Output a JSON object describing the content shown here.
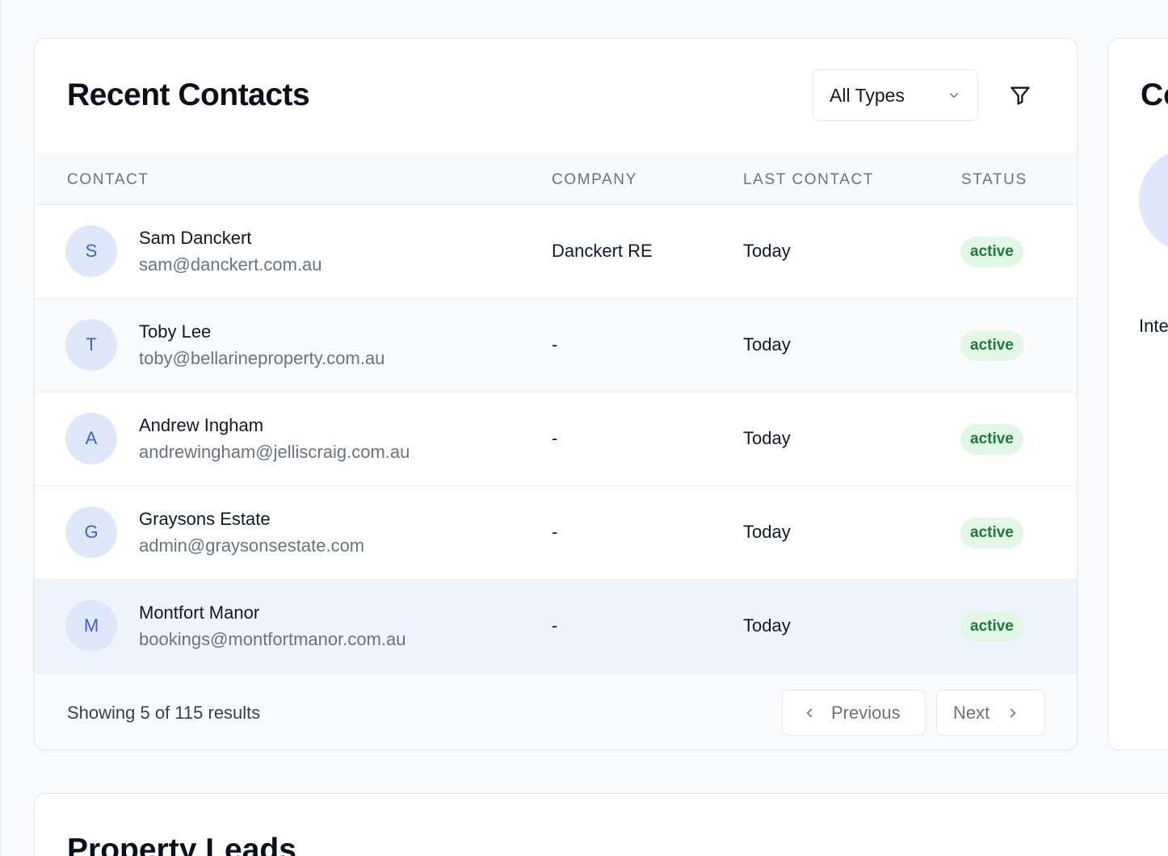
{
  "recent_contacts": {
    "title": "Recent Contacts",
    "type_filter": {
      "selected": "All Types"
    },
    "columns": [
      "CONTACT",
      "COMPANY",
      "LAST CONTACT",
      "STATUS"
    ],
    "rows": [
      {
        "initial": "S",
        "name": "Sam Danckert",
        "email": "sam@danckert.com.au",
        "company": "Danckert RE",
        "last_contact": "Today",
        "status": "active"
      },
      {
        "initial": "T",
        "name": "Toby Lee",
        "email": "toby@bellarineproperty.com.au",
        "company": "-",
        "last_contact": "Today",
        "status": "active"
      },
      {
        "initial": "A",
        "name": "Andrew Ingham",
        "email": "andrewingham@jelliscraig.com.au",
        "company": "-",
        "last_contact": "Today",
        "status": "active"
      },
      {
        "initial": "G",
        "name": "Graysons Estate",
        "email": "admin@graysonsestate.com",
        "company": "-",
        "last_contact": "Today",
        "status": "active"
      },
      {
        "initial": "M",
        "name": "Montfort Manor",
        "email": "bookings@montfortmanor.com.au",
        "company": "-",
        "last_contact": "Today",
        "status": "active"
      }
    ],
    "footer": {
      "showing": "Showing 5 of 115 results",
      "previous_label": "Previous",
      "next_label": "Next"
    }
  },
  "side_card": {
    "title": "Co",
    "label": "Inte"
  },
  "property_leads": {
    "title": "Property Leads"
  },
  "colors": {
    "accent": "#3a63d6",
    "avatar_bg": "#dfe8fb",
    "status_active_bg": "#e2f7e6",
    "status_active_text": "#1d7a3a",
    "row_hover": "#eff5fe"
  }
}
